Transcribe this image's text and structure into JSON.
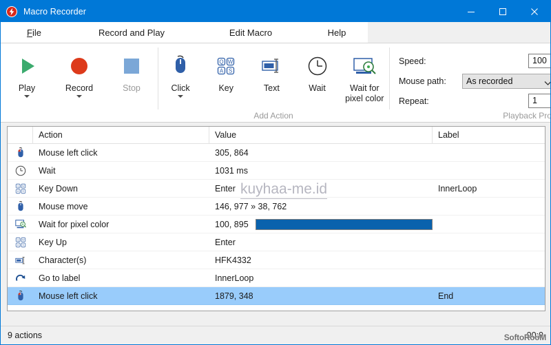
{
  "window": {
    "title": "Macro Recorder",
    "app_icon": "lightning-bolt-icon",
    "minimize_label": "–",
    "maximize_label": "□",
    "close_label": "✕",
    "titlebar_color": "#0078d7"
  },
  "tabs": [
    {
      "label": "File",
      "mnemonic": "F",
      "active": false
    },
    {
      "label": "Record and Play",
      "active": true
    },
    {
      "label": "Edit Macro",
      "active": false
    },
    {
      "label": "Help",
      "active": false
    }
  ],
  "ribbon": {
    "playback_group_label": "",
    "add_action_group_label": "Add Action",
    "playback_group_title": "Playback Properties",
    "buttons": [
      {
        "label": "Play",
        "icon": "play-triangle-icon",
        "caret": true,
        "disabled": false
      },
      {
        "label": "Record",
        "icon": "record-circle-icon",
        "caret": true,
        "disabled": false
      },
      {
        "label": "Stop",
        "icon": "stop-square-icon",
        "caret": false,
        "disabled": true
      },
      {
        "label": "Click",
        "icon": "mouse-icon",
        "caret": true,
        "disabled": false
      },
      {
        "label": "Key",
        "icon": "keyboard-keys-icon",
        "caret": false,
        "disabled": false
      },
      {
        "label": "Text",
        "icon": "text-field-icon",
        "caret": false,
        "disabled": false
      },
      {
        "label": "Wait",
        "icon": "clock-icon",
        "caret": false,
        "disabled": false
      },
      {
        "label": "Wait for\npixel color",
        "icon": "monitor-magnifier-icon",
        "caret": false,
        "disabled": false
      }
    ],
    "playback": {
      "speed_label": "Speed:",
      "speed_value": "100",
      "mouse_path_label": "Mouse path:",
      "mouse_path_value": "As recorded",
      "mouse_path_options": [
        "As recorded"
      ],
      "repeat_label": "Repeat:",
      "repeat_value": "1"
    }
  },
  "table": {
    "columns": [
      "",
      "Action",
      "Value",
      "Label"
    ],
    "rows": [
      {
        "icon": "mouse-left-click-icon",
        "action": "Mouse left click",
        "value": "305, 864",
        "label": "",
        "selected": false,
        "swatch": null
      },
      {
        "icon": "clock-icon",
        "action": "Wait",
        "value": "1031 ms",
        "label": "",
        "selected": false,
        "swatch": null
      },
      {
        "icon": "keyboard-keys-icon",
        "action": "Key Down",
        "value": "Enter",
        "label": "InnerLoop",
        "selected": false,
        "swatch": null
      },
      {
        "icon": "mouse-move-icon",
        "action": "Mouse move",
        "value": "146, 977 » 38, 762",
        "label": "",
        "selected": false,
        "swatch": null
      },
      {
        "icon": "monitor-magnifier-icon",
        "action": "Wait for pixel color",
        "value": "100, 895",
        "label": "",
        "selected": false,
        "swatch": "#0a62ad"
      },
      {
        "icon": "keyboard-keys-icon",
        "action": "Key Up",
        "value": "Enter",
        "label": "",
        "selected": false,
        "swatch": null
      },
      {
        "icon": "text-field-icon",
        "action": "Character(s)",
        "value": "HFK4332",
        "label": "",
        "selected": false,
        "swatch": null
      },
      {
        "icon": "goto-arrow-icon",
        "action": "Go to label",
        "value": "InnerLoop",
        "label": "",
        "selected": false,
        "swatch": null
      },
      {
        "icon": "mouse-left-click-icon",
        "action": "Mouse left click",
        "value": "1879, 348",
        "label": "End",
        "selected": true,
        "swatch": null
      }
    ]
  },
  "watermarks": {
    "center": "kuyhaa-me.id",
    "corner": "SoftoRooM"
  },
  "statusbar": {
    "actions_text": "9 actions",
    "time_text": "00:0"
  }
}
